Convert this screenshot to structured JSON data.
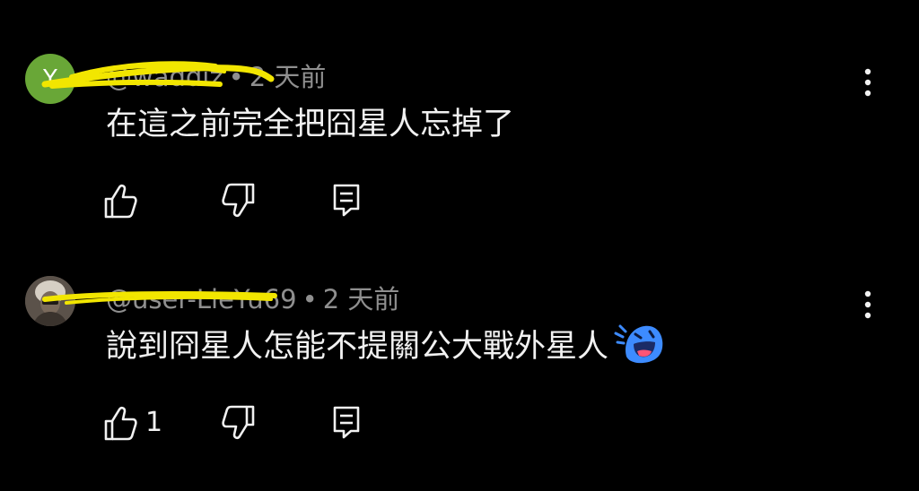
{
  "comments": [
    {
      "avatar_initial": "Y",
      "username": "@waddiz",
      "separator": "•",
      "time": "2 天前",
      "text": "在這之前完全把囧星人忘掉了",
      "like_count": ""
    },
    {
      "username": "@user-LieYu69",
      "separator": "•",
      "time": "2 天前",
      "text": "說到冏星人怎能不提關公大戰外星人",
      "like_count": "1"
    }
  ],
  "colors": {
    "background": "#000000",
    "text": "#f1f1f1",
    "meta": "#8f8f8f",
    "highlighter": "#f2e600",
    "avatar_green": "#69a737"
  },
  "icons": {
    "like": "thumbs-up-icon",
    "dislike": "thumbs-down-icon",
    "reply": "reply-comment-icon",
    "more": "more-vertical-icon",
    "emoji": "laughing-blue-face-emoji"
  }
}
